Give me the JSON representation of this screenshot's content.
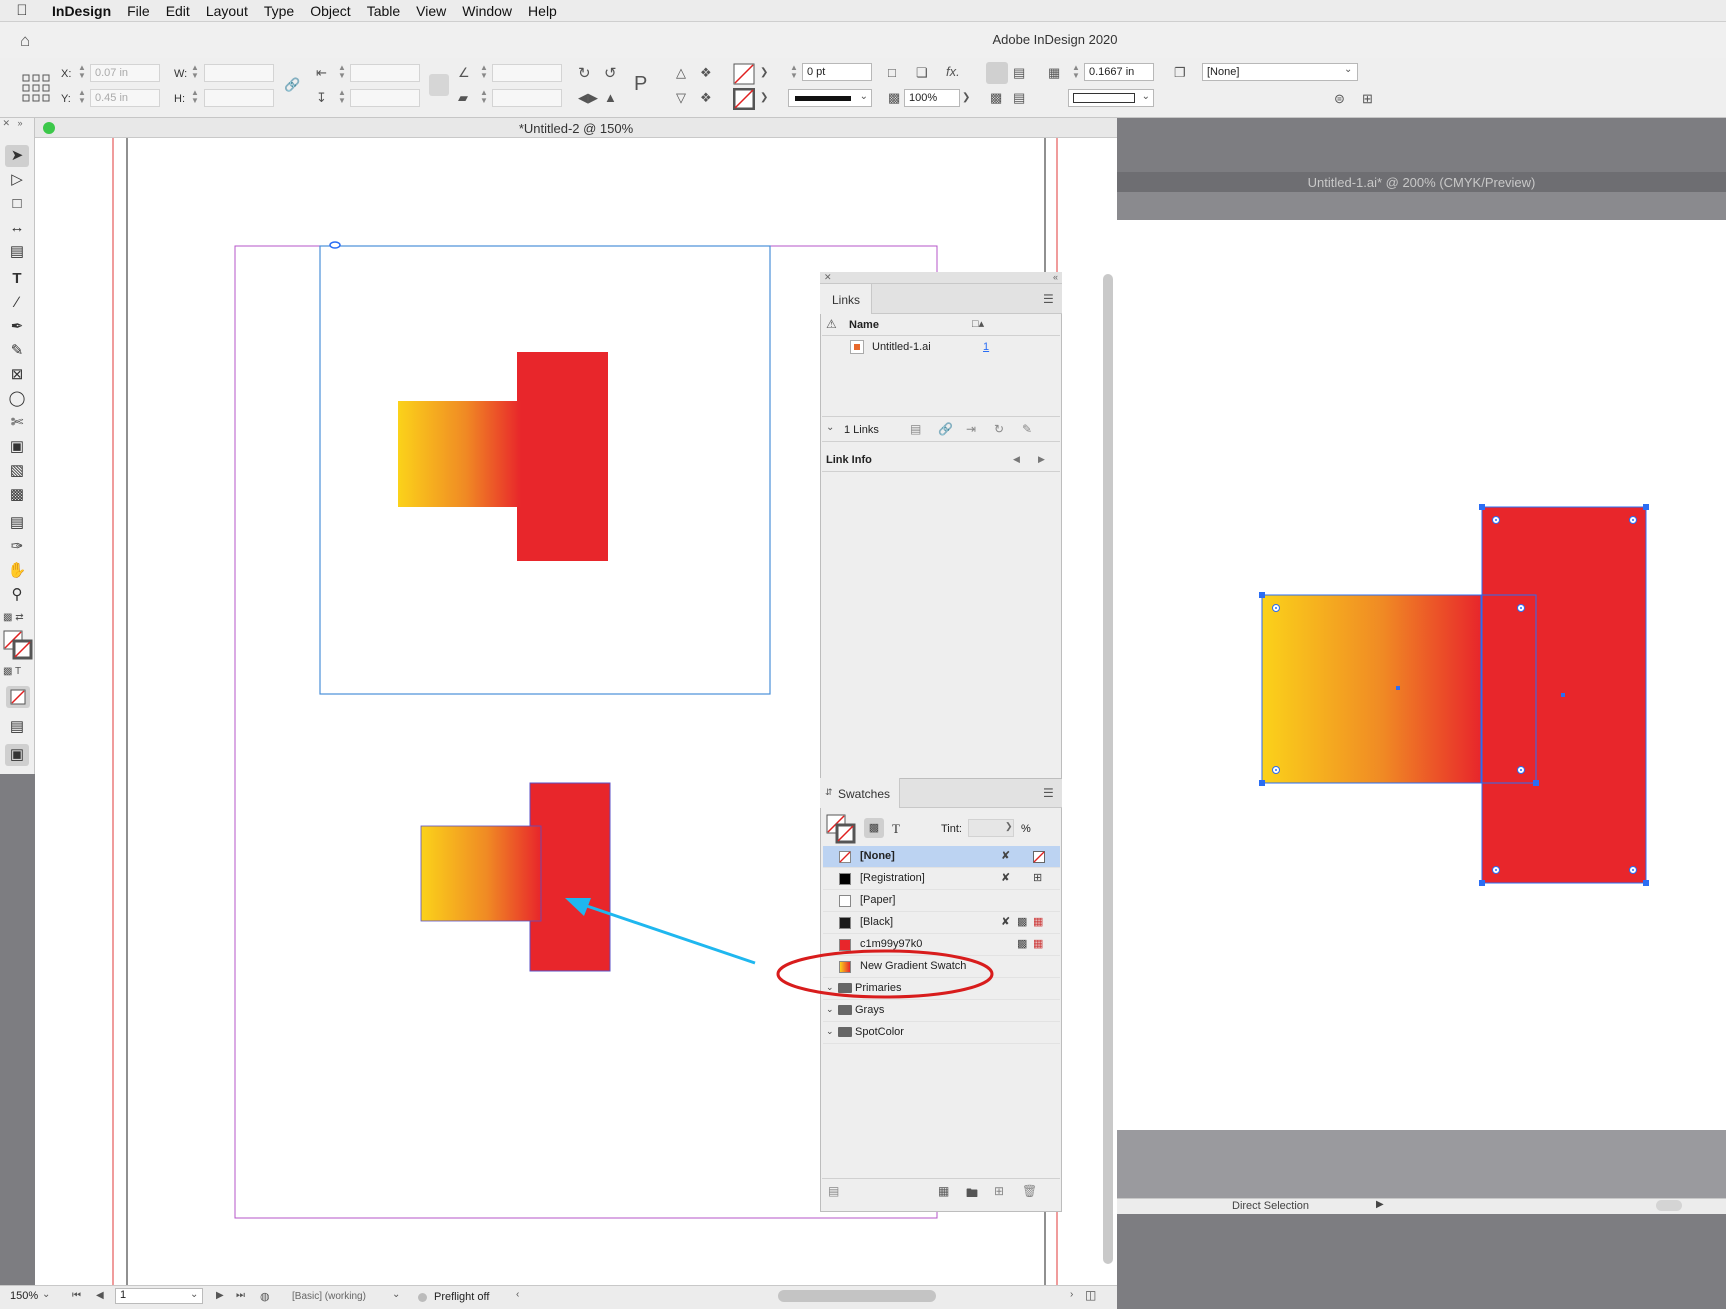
{
  "menubar": {
    "apple": "",
    "app": "InDesign",
    "items": [
      "File",
      "Edit",
      "Layout",
      "Type",
      "Object",
      "Table",
      "View",
      "Window",
      "Help"
    ]
  },
  "app_title": "Adobe InDesign 2020",
  "control": {
    "x_label": "X:",
    "x_value": "0.07 in",
    "y_label": "Y:",
    "y_value": "0.45 in",
    "w_label": "W:",
    "h_label": "H:",
    "stroke_weight": "0 pt",
    "opacity": "100%",
    "gap_value": "0.1667 in",
    "object_style": "[None]",
    "fx": "fx."
  },
  "document": {
    "title": "*Untitled-2 @ 150%"
  },
  "status": {
    "zoom": "150%",
    "page": "1",
    "preflight_profile": "[Basic] (working)",
    "preflight": "Preflight off"
  },
  "links_panel": {
    "tab": "Links",
    "column_name": "Name",
    "items": [
      {
        "name": "Untitled-1.ai",
        "page": "1"
      }
    ],
    "count": "1 Links",
    "info_title": "Link Info"
  },
  "swatches_panel": {
    "tab": "Swatches",
    "tint_label": "Tint:",
    "tint_unit": "%",
    "items": [
      {
        "name": "[None]",
        "color": "#ffffff",
        "selected": true
      },
      {
        "name": "[Registration]",
        "color": "#000000"
      },
      {
        "name": "[Paper]",
        "color": "#ffffff"
      },
      {
        "name": "[Black]",
        "color": "#1a1a1a"
      },
      {
        "name": "c1m99y97k0",
        "color": "#e8262b"
      },
      {
        "name": "New Gradient Swatch",
        "color": "#f08a24"
      }
    ],
    "groups": [
      "Primaries",
      "Grays",
      "SpotColor"
    ]
  },
  "illustrator": {
    "title": "Untitled-1.ai* @ 200% (CMYK/Preview)",
    "status": "Direct Selection"
  },
  "colors": {
    "red": "#e8262b",
    "gradient_start": "#fbd21a",
    "gradient_end": "#e8262b",
    "annotation_arrow": "#1fb7ef",
    "annotation_circle": "#d81c1c",
    "selection": "#2a6df4"
  }
}
